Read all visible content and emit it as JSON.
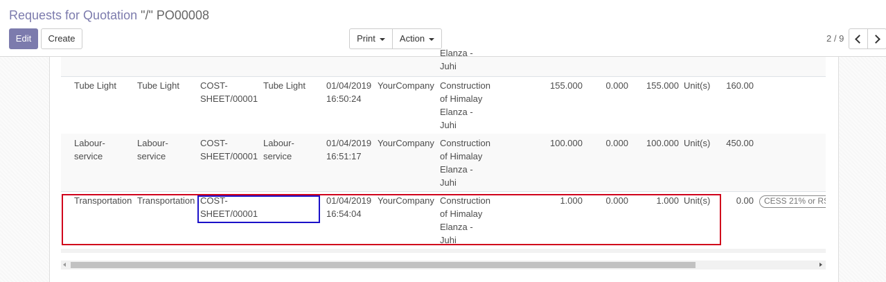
{
  "control_panel": {
    "breadcrumb_parent": "Requests for Quotation",
    "breadcrumb_sep": " \"/\" ",
    "breadcrumb_current": "PO00008",
    "edit_label": "Edit",
    "create_label": "Create",
    "print_label": "Print",
    "action_label": "Action",
    "pager_value": "2 / 9"
  },
  "colors": {
    "primary": "#7c7bad",
    "highlight_row": "#d0021b",
    "highlight_cell": "#1a10c8"
  },
  "table": {
    "top_partial": {
      "partner": "Elanza -\nJuhi"
    },
    "rows": [
      {
        "product": "Tube Light",
        "description": "Tube Light",
        "analytic": "COST-\nSHEET/00001",
        "label": "Tube Light",
        "date": "01/04/2019\n16:50:24",
        "company": "YourCompany",
        "project": "Construction\nof Himalay\nElanza -\nJuhi",
        "qty": "155.000",
        "received": "0.000",
        "billed": "155.000",
        "uom": "Unit(s)",
        "price": "160.00",
        "tax": ""
      },
      {
        "product": "Labour-\nservice",
        "description": "Labour-\nservice",
        "analytic": "COST-\nSHEET/00001",
        "label": "Labour-\nservice",
        "date": "01/04/2019\n16:51:17",
        "company": "YourCompany",
        "project": "Construction\nof Himalay\nElanza -\nJuhi",
        "qty": "100.000",
        "received": "0.000",
        "billed": "100.000",
        "uom": "Unit(s)",
        "price": "450.00",
        "tax": ""
      },
      {
        "product": "Transportation",
        "description": "Transportation",
        "analytic": "COST-\nSHEET/00001",
        "label": "",
        "date": "01/04/2019\n16:54:04",
        "company": "YourCompany",
        "project": "Construction\nof Himalay\nElanza -\nJuhi",
        "qty": "1.000",
        "received": "0.000",
        "billed": "1.000",
        "uom": "Unit(s)",
        "price": "0.00",
        "tax": "CESS 21% or RS"
      }
    ]
  }
}
